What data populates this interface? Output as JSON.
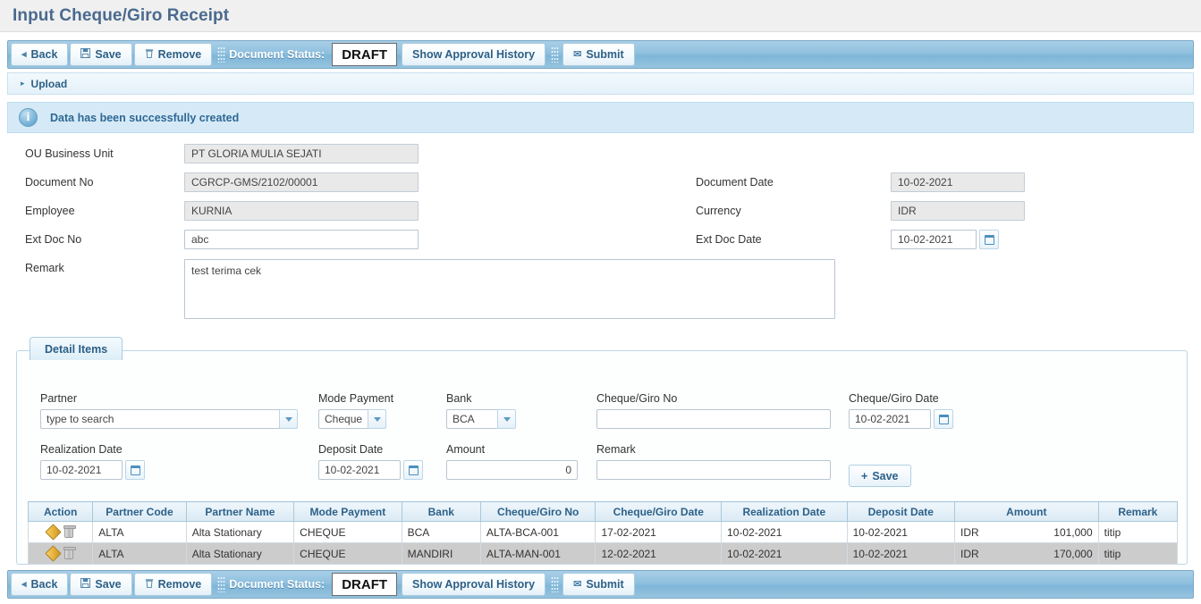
{
  "page": {
    "title": "Input Cheque/Giro Receipt"
  },
  "toolbar": {
    "back_label": "Back",
    "save_label": "Save",
    "remove_label": "Remove",
    "status_label": "Document Status:",
    "status_value": "DRAFT",
    "approval_label": "Show Approval History",
    "submit_label": "Submit",
    "back_icon": "◂",
    "save_icon": "💾",
    "remove_icon": "🗑",
    "submit_icon": "✉"
  },
  "upload": {
    "label": "Upload",
    "arrow": "▸"
  },
  "info": {
    "icon": "i",
    "message": "Data has been successfully created"
  },
  "form": {
    "ou_business_unit": {
      "label": "OU Business Unit",
      "value": "PT GLORIA MULIA SEJATI"
    },
    "document_no": {
      "label": "Document No",
      "value": "CGRCP-GMS/2102/00001"
    },
    "employee": {
      "label": "Employee",
      "value": "KURNIA"
    },
    "ext_doc_no": {
      "label": "Ext Doc No",
      "value": "abc"
    },
    "remark": {
      "label": "Remark",
      "value": "test terima cek"
    },
    "document_date": {
      "label": "Document Date",
      "value": "10-02-2021"
    },
    "currency": {
      "label": "Currency",
      "value": "IDR"
    },
    "ext_doc_date": {
      "label": "Ext Doc Date",
      "value": "10-02-2021"
    }
  },
  "detail": {
    "tab_label": "Detail Items",
    "partner": {
      "label": "Partner",
      "placeholder": "type to search",
      "value": ""
    },
    "mode_payment": {
      "label": "Mode Payment",
      "value": "Cheque"
    },
    "bank": {
      "label": "Bank",
      "value": "BCA"
    },
    "cheque_giro_no": {
      "label": "Cheque/Giro No",
      "value": ""
    },
    "cheque_giro_date": {
      "label": "Cheque/Giro Date",
      "value": "10-02-2021"
    },
    "realization_date": {
      "label": "Realization Date",
      "value": "10-02-2021"
    },
    "deposit_date": {
      "label": "Deposit Date",
      "value": "10-02-2021"
    },
    "amount": {
      "label": "Amount",
      "value": "0"
    },
    "remark": {
      "label": "Remark",
      "value": ""
    },
    "save_button": {
      "label": "Save",
      "icon": "+"
    }
  },
  "grid": {
    "columns": [
      "Action",
      "Partner Code",
      "Partner Name",
      "Mode Payment",
      "Bank",
      "Cheque/Giro No",
      "Cheque/Giro Date",
      "Realization Date",
      "Deposit Date",
      "Amount",
      "Remark"
    ],
    "rows": [
      {
        "partner_code": "ALTA",
        "partner_name": "Alta Stationary",
        "mode_payment": "CHEQUE",
        "bank": "BCA",
        "cheque_giro_no": "ALTA-BCA-001",
        "cheque_giro_date": "17-02-2021",
        "realization_date": "10-02-2021",
        "deposit_date": "10-02-2021",
        "amount_currency": "IDR",
        "amount_value": "101,000",
        "remark": "titip"
      },
      {
        "partner_code": "ALTA",
        "partner_name": "Alta Stationary",
        "mode_payment": "CHEQUE",
        "bank": "MANDIRI",
        "cheque_giro_no": "ALTA-MAN-001",
        "cheque_giro_date": "12-02-2021",
        "realization_date": "10-02-2021",
        "deposit_date": "10-02-2021",
        "amount_currency": "IDR",
        "amount_value": "170,000",
        "remark": "titip"
      }
    ]
  },
  "colors": {
    "title": "#4a6a8f",
    "toolbar_blue": "#8fc0de",
    "info_bg": "#d5eaf6",
    "grid_header": "#dbeaf5",
    "row_alt": "#cccccc"
  }
}
